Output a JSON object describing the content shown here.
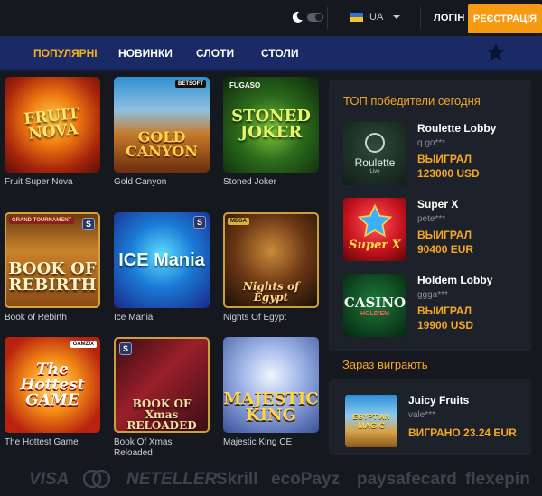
{
  "header": {
    "lang_code": "UA",
    "login_label": "ЛОГІН",
    "register_label": "РЕЄСТРАЦІЯ"
  },
  "nav": {
    "items": [
      {
        "label": "ПОПУЛЯРНІ",
        "active": true
      },
      {
        "label": "НОВИНКИ",
        "active": false
      },
      {
        "label": "СЛОТИ",
        "active": false
      },
      {
        "label": "СТОЛИ",
        "active": false
      }
    ]
  },
  "games": [
    {
      "name": "Fruit Super Nova",
      "thumb_text": "FRUIT NOVA"
    },
    {
      "name": "Gold Canyon",
      "thumb_text": "GOLD CANYON",
      "provider": "BETSOFT"
    },
    {
      "name": "Stoned Joker",
      "thumb_text": "STONED JOKER",
      "provider": "FUGASO"
    },
    {
      "name": "Book of Rebirth",
      "thumb_text": "BOOK OF REBIRTH",
      "badge": "GRAND TOURNAMENT"
    },
    {
      "name": "Ice Mania",
      "thumb_text": "ICE Mania"
    },
    {
      "name": "Nights Of Egypt",
      "thumb_text": "Nights of Egypt",
      "badge": "MEGA"
    },
    {
      "name": "The Hottest Game",
      "thumb_text": "The Hottest GAME",
      "provider": "GAMZIX"
    },
    {
      "name": "Book Of Xmas Reloaded",
      "thumb_text": "BOOK OF Xmas RELOADED"
    },
    {
      "name": "Majestic King CE",
      "thumb_text": "MAJESTIC KING"
    }
  ],
  "top_winners": {
    "title": "ТОП победители сегодня",
    "items": [
      {
        "game": "Roulette Lobby",
        "user": "q.go***",
        "label": "ВЫИГРАЛ",
        "amount": "123000 USD",
        "thumb_text": "Roulette",
        "thumb_sub": "Live"
      },
      {
        "game": "Super X",
        "user": "pete***",
        "label": "ВЫИГРАЛ",
        "amount": "90400 EUR",
        "thumb_text": "Super X"
      },
      {
        "game": "Holdem Lobby",
        "user": "ggga***",
        "label": "ВЫИГРАЛ",
        "amount": "19900 USD",
        "thumb_text": "CASINO",
        "thumb_sub": "HOLD'EM"
      }
    ]
  },
  "playing_now": {
    "title": "Зараз виграють",
    "item": {
      "game": "Juicy Fruits",
      "user": "vale***",
      "amount": "ВИГРАНО 23.24 EUR",
      "thumb_text": "EGYPTIAN",
      "thumb_sub": "MAGIC"
    }
  },
  "payments": [
    "VISA",
    "NETELLER",
    "Skrill",
    "ecoPayz",
    "paysafecard",
    "flexepin"
  ],
  "colors": {
    "accent": "#f59a12",
    "nav_bg": "#1a2a66",
    "active_nav": "#f5b21a",
    "gold": "#f5a623"
  }
}
